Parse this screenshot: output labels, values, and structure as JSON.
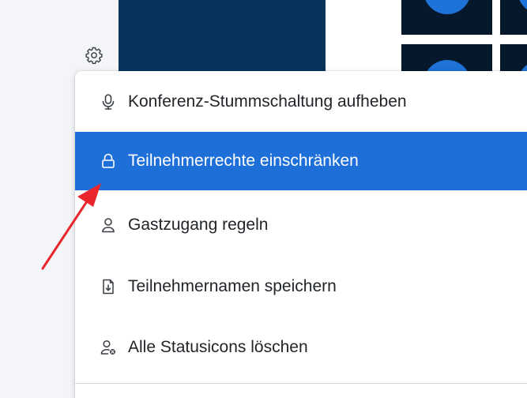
{
  "menu": {
    "items": [
      {
        "label": "Konferenz-Stummschaltung aufheben",
        "icon": "microphone-icon"
      },
      {
        "label": "Teilnehmerrechte einschränken",
        "icon": "lock-icon"
      },
      {
        "label": "Gastzugang regeln",
        "icon": "user-icon"
      },
      {
        "label": "Teilnehmernamen speichern",
        "icon": "file-download-icon"
      },
      {
        "label": "Alle Statusicons löschen",
        "icon": "user-clear-status-icon"
      }
    ]
  },
  "colors": {
    "accent": "#1e6fd8",
    "presentation_bg": "#06345a",
    "tile_bg": "#06182c",
    "avatar": "#1f72d8",
    "arrow": "#e8262b"
  },
  "annotation": {
    "icon": "red-arrow"
  }
}
